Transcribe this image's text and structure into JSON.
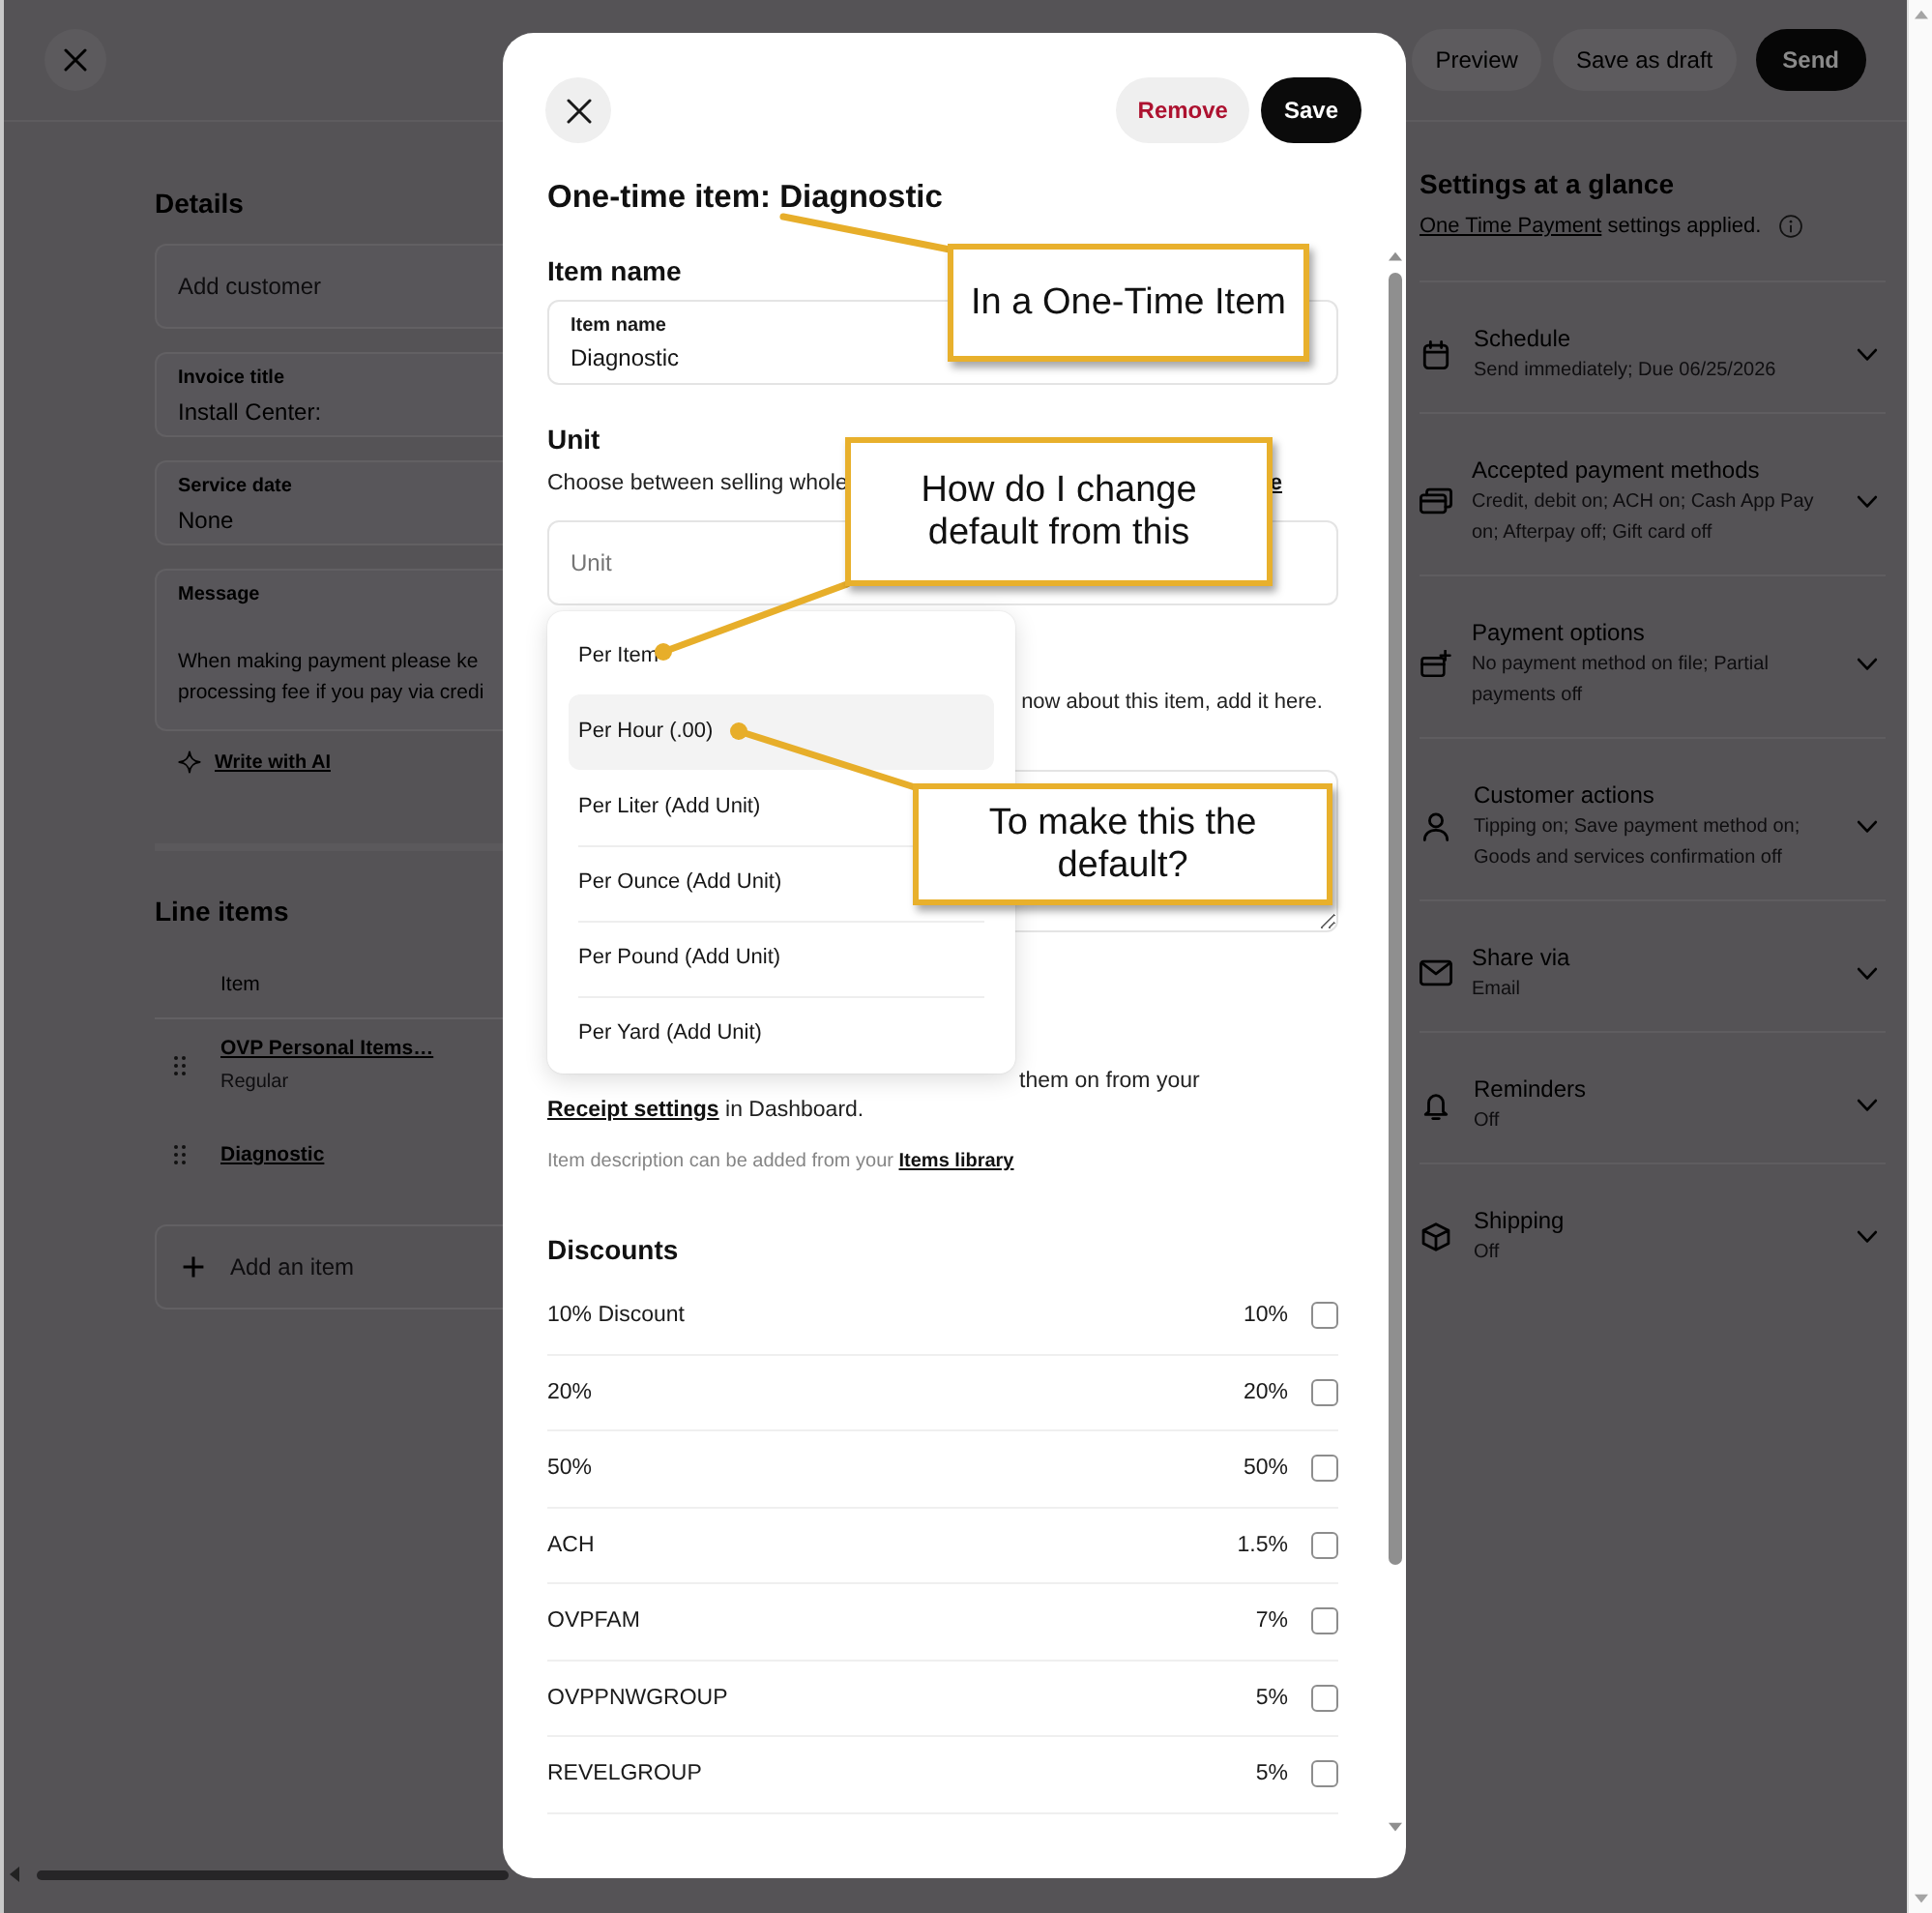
{
  "invoice_editor": {
    "header_buttons": [
      {
        "label": "Preview",
        "kind": "secondary"
      },
      {
        "label": "Save as draft",
        "kind": "secondary"
      },
      {
        "label": "Send",
        "kind": "primary"
      }
    ],
    "details": {
      "title": "Details",
      "fields": [
        {
          "kind": "placeholder",
          "placeholder": "Add customer"
        },
        {
          "kind": "text",
          "label": "Invoice title",
          "value": "Install Center:"
        },
        {
          "kind": "text",
          "label": "Service date",
          "value": "None"
        },
        {
          "kind": "multiline",
          "label": "Message",
          "lines": [
            "When making payment please ke",
            "processing fee if you pay via credi"
          ]
        }
      ],
      "ai_link": "Write with AI"
    },
    "line_items": {
      "title": "Line items",
      "column": "Item",
      "rows": [
        {
          "name": "OVP Personal Items…",
          "subtitle": "Regular"
        },
        {
          "name": "Diagnostic"
        }
      ],
      "add_item": {
        "placeholder": "Add an item"
      }
    },
    "settings": {
      "title": "Settings at a glance",
      "applied": {
        "link": "One Time Payment",
        "text": " settings applied."
      },
      "items": [
        {
          "title": "Schedule",
          "summary": [
            "Send immediately; Due 06/25/2026"
          ],
          "expanded": false
        },
        {
          "title": "Accepted payment methods",
          "summary": [
            "Credit, debit on; ACH on; Cash App Pay",
            "on; Afterpay off; Gift card off"
          ],
          "expanded": false
        },
        {
          "title": "Payment options",
          "summary": [
            "No payment method on file; Partial",
            "payments off"
          ],
          "expanded": false
        },
        {
          "title": "Customer actions",
          "summary": [
            "Tipping on; Save payment method on;",
            "Goods and services confirmation off"
          ],
          "expanded": false
        },
        {
          "title": "Share via",
          "summary": [
            "Email"
          ],
          "expanded": false
        },
        {
          "title": "Reminders",
          "summary": [
            "Off"
          ],
          "expanded": false
        },
        {
          "title": "Shipping",
          "summary": [
            "Off"
          ],
          "expanded": false
        }
      ]
    }
  },
  "modal": {
    "buttons": [
      {
        "label": "Remove",
        "kind": "danger"
      },
      {
        "label": "Save",
        "kind": "primary"
      }
    ],
    "title": "One-time item: Diagnostic",
    "item_name": {
      "heading": "Item name",
      "label": "Item name",
      "value": "Diagnostic"
    },
    "unit": {
      "heading": "Unit",
      "description": "Choose between selling whole",
      "description_link": "e",
      "placeholder": "Unit",
      "options": [
        {
          "label": "Per Item",
          "selected": false
        },
        {
          "label": "Per Hour (.00)",
          "selected": true
        },
        {
          "label": "Per Liter (Add Unit)",
          "selected": false
        },
        {
          "label": "Per Ounce (Add Unit)",
          "selected": false
        },
        {
          "label": "Per Pound (Add Unit)",
          "selected": false
        },
        {
          "label": "Per Yard (Add Unit)",
          "selected": false
        }
      ]
    },
    "description": {
      "hint": "now about this item, add it here.",
      "receipt_note": {
        "text": "them on from your ",
        "link": "Receipt settings",
        "after": " in Dashboard."
      },
      "library_note": {
        "text": "Item description can be added from your ",
        "link": "Items library"
      }
    },
    "discounts": {
      "heading": "Discounts",
      "rows": [
        {
          "name": "10% Discount",
          "amount": "10%",
          "checked": false
        },
        {
          "name": "20%",
          "amount": "20%",
          "checked": false
        },
        {
          "name": "50%",
          "amount": "50%",
          "checked": false
        },
        {
          "name": "ACH",
          "amount": "1.5%",
          "checked": false
        },
        {
          "name": "OVPFAM",
          "amount": "7%",
          "checked": false
        },
        {
          "name": "OVPPNWGROUP",
          "amount": "5%",
          "checked": false
        },
        {
          "name": "REVELGROUP",
          "amount": "5%",
          "checked": false
        }
      ]
    }
  },
  "annotations": [
    {
      "text": "In a One-Time Item"
    },
    {
      "text": "How do I change default from this"
    },
    {
      "text": "To make this the default?"
    }
  ]
}
